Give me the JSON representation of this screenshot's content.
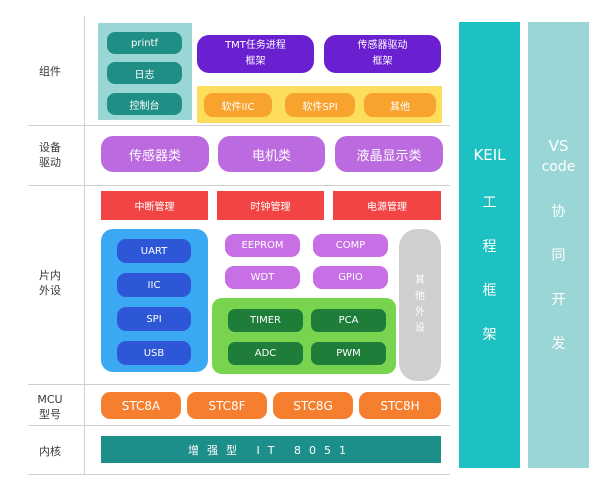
{
  "row_labels": {
    "components": "组件",
    "drivers": [
      "设备",
      "驱动"
    ],
    "peripherals": [
      "片内",
      "外设"
    ],
    "mcu": [
      "MCU",
      "型号"
    ],
    "core": "内核"
  },
  "components": {
    "teal_items": [
      "printf",
      "日志",
      "控制台"
    ],
    "frameworks": [
      [
        "TMT任务进程",
        "框架"
      ],
      [
        "传感器驱动",
        "框架"
      ]
    ],
    "soft_items": [
      "软件IIC",
      "软件SPI",
      "其他"
    ]
  },
  "drivers": [
    "传感器类",
    "电机类",
    "液晶显示类"
  ],
  "managers": [
    "中断管理",
    "时钟管理",
    "电源管理"
  ],
  "peripherals": {
    "blue": [
      "UART",
      "IIC",
      "SPI",
      "USB"
    ],
    "purple": [
      "EEPROM",
      "COMP",
      "WDT",
      "GPIO"
    ],
    "green": [
      "TIMER",
      "PCA",
      "ADC",
      "PWM"
    ],
    "other": [
      "其",
      "他",
      "外",
      "设"
    ]
  },
  "mcu_models": [
    "STC8A",
    "STC8F",
    "STC8G",
    "STC8H"
  ],
  "core_label": "增强型 IT 8051",
  "keil_column": [
    "KEIL",
    "工",
    "程",
    "框",
    "架"
  ],
  "vscode_column": [
    "VS",
    "code",
    "协",
    "同",
    "开",
    "发"
  ],
  "colors": {
    "teal": "#1ec1c1",
    "light_teal": "#9ad6d6",
    "purple": "#6a1fd1",
    "lavender": "#bb6ae0",
    "red": "#f24444",
    "blue": "#3aa8f2",
    "green": "#78d44f",
    "orange": "#f57f2e",
    "yellow": "#fddd5c"
  }
}
